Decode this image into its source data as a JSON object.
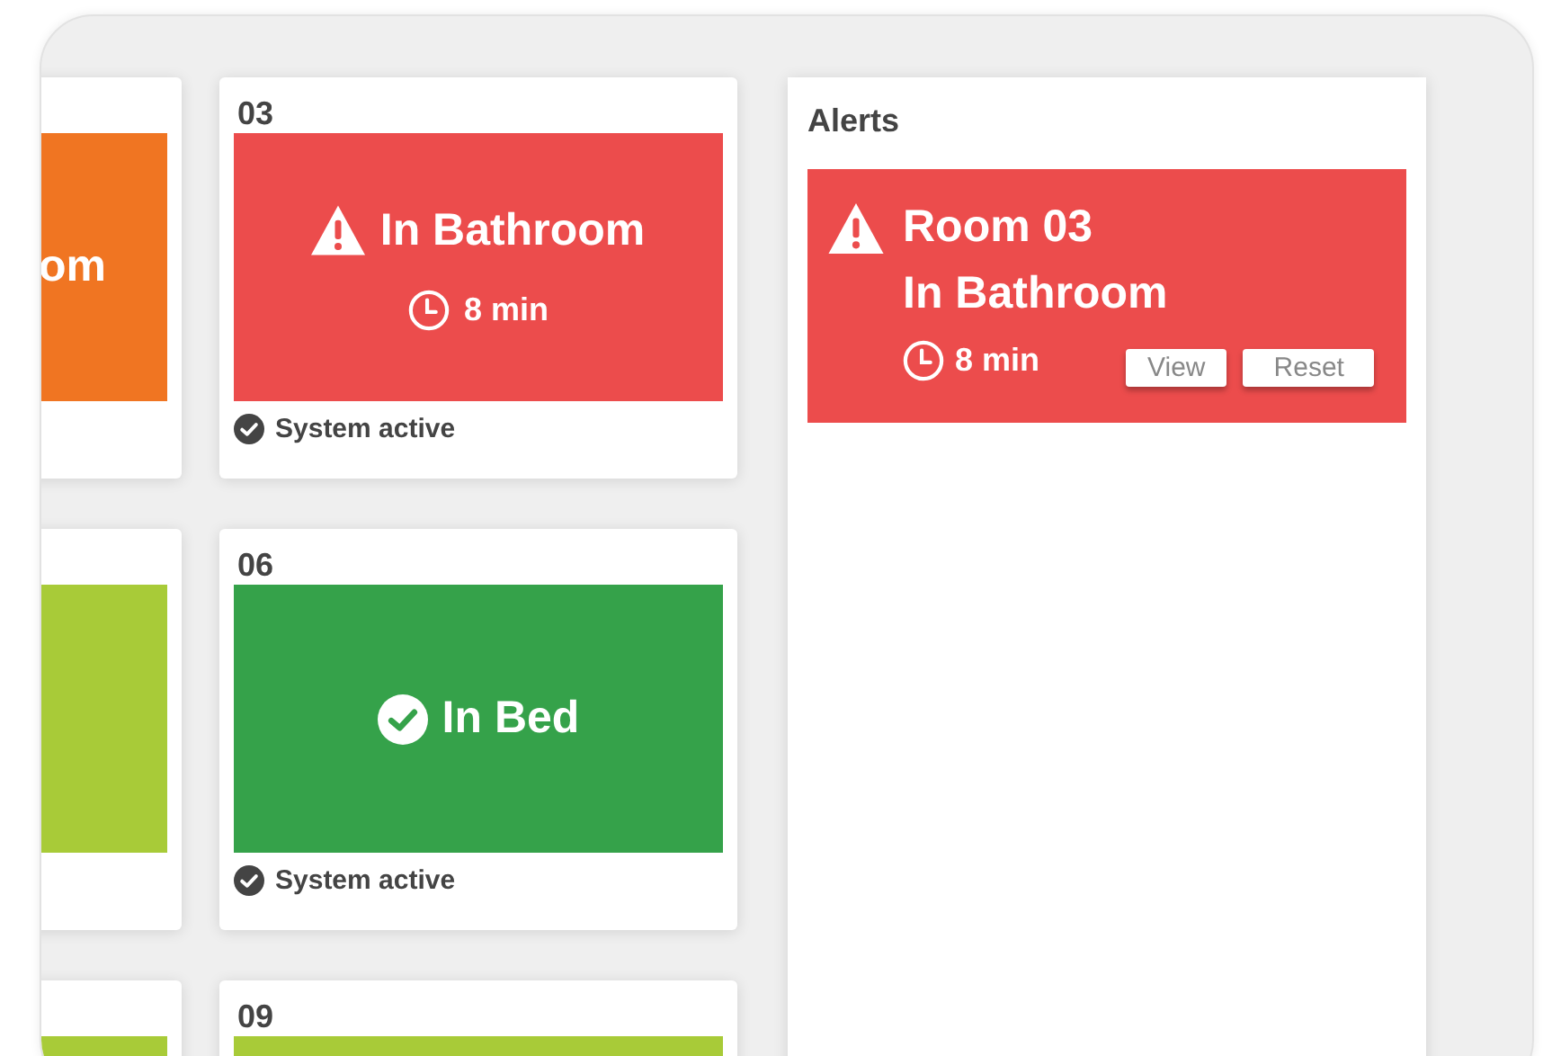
{
  "rooms": [
    {
      "kind": "plain",
      "color": "#f07522",
      "status": "om"
    },
    {
      "number": "03",
      "kind": "alert",
      "color": "#ec4c4c",
      "status": "In Bathroom",
      "time": "8 min",
      "system_status": "System active"
    },
    {
      "kind": "plain",
      "color": "#a8cb38"
    },
    {
      "number": "06",
      "kind": "ok",
      "color": "#35a24a",
      "status": "In Bed",
      "system_status": "System active"
    },
    {
      "kind": "plain",
      "color": "#a8cb38"
    },
    {
      "number": "09",
      "kind": "plain",
      "color": "#a8cb38"
    }
  ],
  "alerts": {
    "title": "Alerts",
    "items": [
      {
        "room": "Room 03",
        "status": "In Bathroom",
        "time": "8 min",
        "buttons": [
          "View",
          "Reset"
        ]
      }
    ]
  }
}
